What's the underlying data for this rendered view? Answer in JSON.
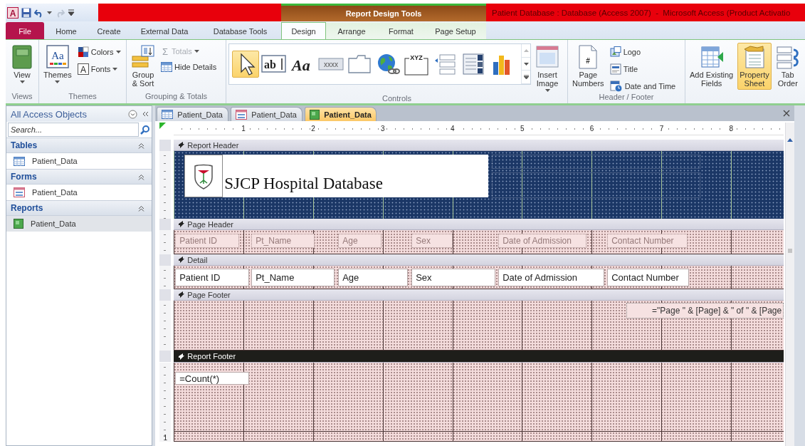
{
  "title_bar": {
    "app_icon": "A",
    "context_group": "Report Design Tools",
    "title": "Patient Database : Database (Access 2007)  -  Microsoft Access (Product Activatio"
  },
  "ribbon_tabs": [
    {
      "label": "File",
      "kind": "file",
      "selected": false
    },
    {
      "label": "Home",
      "kind": "tab",
      "selected": false
    },
    {
      "label": "Create",
      "kind": "tab",
      "selected": false
    },
    {
      "label": "External Data",
      "kind": "tab",
      "selected": false
    },
    {
      "label": "Database Tools",
      "kind": "tab",
      "selected": false
    },
    {
      "label": "Design",
      "kind": "context",
      "selected": true
    },
    {
      "label": "Arrange",
      "kind": "context",
      "selected": false
    },
    {
      "label": "Format",
      "kind": "context",
      "selected": false
    },
    {
      "label": "Page Setup",
      "kind": "context",
      "selected": false
    }
  ],
  "ribbon_groups": [
    {
      "label": "Views",
      "items": [
        {
          "kind": "large",
          "lines": [
            "View"
          ],
          "dropdown": true,
          "selected": false
        }
      ]
    },
    {
      "label": "Themes",
      "items": [
        {
          "kind": "large",
          "lines": [
            "Themes"
          ],
          "glyph": "Aa",
          "dropdown": true,
          "selected": false
        },
        {
          "kind": "stack",
          "buttons": [
            {
              "label": "Colors",
              "dropdown": true,
              "disabled": false
            },
            {
              "label": "Fonts",
              "glyph": "A",
              "dropdown": true,
              "disabled": false
            }
          ]
        }
      ]
    },
    {
      "label": "Grouping & Totals",
      "items": [
        {
          "kind": "large",
          "lines": [
            "Group",
            "& Sort"
          ],
          "dropdown": false,
          "selected": false
        },
        {
          "kind": "stack",
          "buttons": [
            {
              "label": "Totals",
              "glyph": "Σ",
              "dropdown": true,
              "disabled": true
            },
            {
              "label": "Hide Details",
              "dropdown": false,
              "disabled": false
            }
          ]
        }
      ]
    },
    {
      "label": "Controls",
      "items": [
        {
          "kind": "gallery",
          "controls": [
            {
              "selected": true
            },
            {
              "glyph": "ab",
              "selected": false
            },
            {
              "glyph": "Aa",
              "selected": false
            },
            {
              "glyph": "xxxx",
              "selected": false
            },
            {
              "selected": false
            },
            {
              "selected": false
            },
            {
              "glyph": "XYZ",
              "selected": false
            },
            {
              "selected": false
            },
            {
              "selected": false
            },
            {
              "selected": false
            }
          ]
        },
        {
          "kind": "large",
          "lines": [
            "Insert",
            "Image"
          ],
          "dropdown": true,
          "selected": false
        }
      ]
    },
    {
      "label": "Header / Footer",
      "items": [
        {
          "kind": "large",
          "lines": [
            "Page",
            "Numbers"
          ],
          "glyph": "#",
          "dropdown": false,
          "selected": false
        },
        {
          "kind": "stack",
          "buttons": [
            {
              "label": "Logo",
              "dropdown": false,
              "disabled": false
            },
            {
              "label": "Title",
              "dropdown": false,
              "disabled": false
            },
            {
              "label": "Date and Time",
              "dropdown": false,
              "disabled": false
            }
          ]
        }
      ]
    },
    {
      "items": [
        {
          "kind": "large",
          "lines": [
            "Add Existing",
            "Fields"
          ],
          "dropdown": false,
          "selected": false
        },
        {
          "kind": "large",
          "lines": [
            "Property",
            "Sheet"
          ],
          "dropdown": false,
          "selected": true
        },
        {
          "kind": "large",
          "lines": [
            "Tab",
            "Order"
          ],
          "dropdown": false,
          "selected": false
        }
      ]
    }
  ],
  "navigation_pane": {
    "title": "All Access Objects",
    "search": {
      "placeholder": "Search..."
    },
    "groups": [
      {
        "label": "Tables",
        "expanded": true,
        "items": [
          {
            "label": "Patient_Data",
            "selected": false
          }
        ]
      },
      {
        "label": "Forms",
        "expanded": true,
        "items": [
          {
            "label": "Patient_Data",
            "selected": false
          }
        ]
      },
      {
        "label": "Reports",
        "expanded": true,
        "items": [
          {
            "label": "Patient_Data",
            "selected": true
          }
        ]
      }
    ]
  },
  "document_tabs": [
    {
      "label": "Patient_Data",
      "selected": false
    },
    {
      "label": "Patient_Data",
      "selected": false
    },
    {
      "label": "Patient_Data",
      "selected": true
    }
  ],
  "ruler": {
    "marks": [
      "1",
      "2",
      "3",
      "4",
      "5",
      "6",
      "7",
      "8"
    ]
  },
  "vertical_ruler": {
    "marks": [
      "1"
    ]
  },
  "report_sections": [
    {
      "title": "Report Header",
      "kind": "report_header",
      "selected": false,
      "controls": [
        {
          "kind": "logo"
        },
        {
          "kind": "title",
          "text": "SJCP Hospital Database"
        },
        {
          "kind": "empty"
        },
        {
          "kind": "empty"
        }
      ]
    },
    {
      "title": "Page Header",
      "kind": "page_header",
      "selected": false,
      "controls": [
        {
          "kind": "label",
          "text": "Patient ID"
        },
        {
          "kind": "label",
          "text": "Pt_Name"
        },
        {
          "kind": "label",
          "text": "Age"
        },
        {
          "kind": "label",
          "text": "Sex"
        },
        {
          "kind": "label",
          "text": "Date of Admission"
        },
        {
          "kind": "label",
          "text": "Contact Number"
        }
      ]
    },
    {
      "title": "Detail",
      "kind": "detail",
      "selected": false,
      "controls": [
        {
          "kind": "textbox",
          "text": "Patient ID"
        },
        {
          "kind": "textbox",
          "text": "Pt_Name"
        },
        {
          "kind": "textbox",
          "text": "Age"
        },
        {
          "kind": "textbox",
          "text": "Sex"
        },
        {
          "kind": "textbox",
          "text": "Date of Admission"
        },
        {
          "kind": "textbox",
          "text": "Contact Number"
        }
      ]
    },
    {
      "title": "Page Footer",
      "kind": "page_footer",
      "selected": false,
      "controls": [
        {
          "kind": "expression",
          "text": "=\"Page \" & [Page] & \" of \" & [Page"
        }
      ]
    },
    {
      "title": "Report Footer",
      "kind": "report_footer",
      "selected": true,
      "controls": [
        {
          "kind": "textbox",
          "text": "=Count(*)"
        }
      ]
    }
  ]
}
